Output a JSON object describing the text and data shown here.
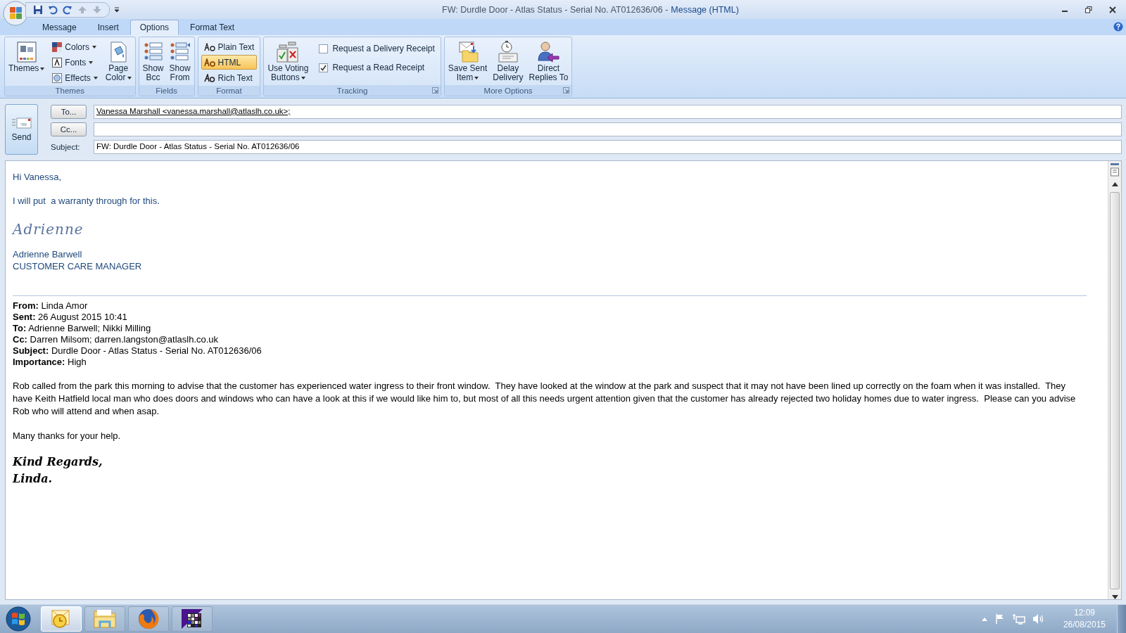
{
  "window": {
    "title": "FW: Durdle Door - Atlas Status - Serial No. AT012636/06 -",
    "app": "Message (HTML)"
  },
  "tabs": [
    {
      "label": "Message",
      "selected": false
    },
    {
      "label": "Insert",
      "selected": false
    },
    {
      "label": "Options",
      "selected": true
    },
    {
      "label": "Format Text",
      "selected": false
    }
  ],
  "ribbon": {
    "groups": [
      {
        "label": "Themes",
        "launcher": false,
        "items": [
          {
            "kind": "large",
            "lines": [
              "Themes"
            ],
            "dropdown": true
          },
          {
            "kind": "small",
            "label": "Colors",
            "dropdown": true
          },
          {
            "kind": "small",
            "label": "Fonts",
            "dropdown": true
          },
          {
            "kind": "small",
            "label": "Effects",
            "dropdown": true
          },
          {
            "kind": "large",
            "lines": [
              "Page",
              "Color"
            ],
            "dropdown": true
          }
        ]
      },
      {
        "label": "Fields",
        "launcher": false,
        "items": [
          {
            "kind": "large",
            "lines": [
              "Show",
              "Bcc"
            ],
            "dropdown": false
          },
          {
            "kind": "large",
            "lines": [
              "Show",
              "From"
            ],
            "dropdown": false
          }
        ]
      },
      {
        "label": "Format",
        "launcher": false,
        "items": [
          {
            "kind": "format",
            "label": "Plain Text",
            "selected": false
          },
          {
            "kind": "format",
            "label": "HTML",
            "selected": true
          },
          {
            "kind": "format",
            "label": "Rich Text",
            "selected": false
          }
        ]
      },
      {
        "label": "Tracking",
        "launcher": true,
        "items": [
          {
            "kind": "large",
            "lines": [
              "Use Voting",
              "Buttons"
            ],
            "dropdown": true
          },
          {
            "kind": "check",
            "label": "Request a Delivery Receipt",
            "checked": false
          },
          {
            "kind": "check",
            "label": "Request a Read Receipt",
            "checked": true
          }
        ]
      },
      {
        "label": "More Options",
        "launcher": true,
        "items": [
          {
            "kind": "large",
            "lines": [
              "Save Sent",
              "Item"
            ],
            "dropdown": true
          },
          {
            "kind": "large",
            "lines": [
              "Delay",
              "Delivery"
            ],
            "dropdown": false
          },
          {
            "kind": "large",
            "lines": [
              "Direct",
              "Replies To"
            ],
            "dropdown": false
          }
        ]
      }
    ]
  },
  "header": {
    "send": "Send",
    "to_button": "To...",
    "cc_button": "Cc...",
    "subject_label": "Subject:",
    "to": "Vanessa Marshall <vanessa.marshall@atlaslh.co.uk>;",
    "subject": "FW: Durdle Door - Atlas Status - Serial No. AT012636/06"
  },
  "message": {
    "greeting": "Hi Vanessa,",
    "line": "I will put  a warranty through for this.",
    "signature_script": "Adrienne",
    "sender_name": "Adrienne Barwell",
    "sender_title": "CUSTOMER CARE MANAGER",
    "forwarded": {
      "headers": [
        "**From:** Linda Amor",
        "**Sent:** 26 August 2015 10:41",
        "**To:** Adrienne Barwell; Nikki Milling",
        "**Cc:** Darren Milsom; darren.langston@atlaslh.co.uk",
        "**Subject:** Durdle Door - Atlas Status - Serial No. AT012636/06",
        "**Importance:** High"
      ],
      "paragraphs": [
        "Rob called from the park this morning to advise that the customer has experienced water ingress to their front window.  They have looked at the window at the park and suspect that it may not have been lined up correctly on the foam when it was installed.  They have Keith Hatfield local man who does doors and windows who can have a look at this if we would like him to, but most of all this needs urgent attention given that the customer has already rejected two holiday homes due to water ingress.  Please can you advise Rob who will attend and when asap.",
        "Many thanks for your help."
      ],
      "sign_off": [
        "Kind Regards,",
        "Linda."
      ]
    }
  },
  "taskbar": {
    "apps": [
      {
        "selected": true
      },
      {
        "selected": false
      },
      {
        "selected": false
      },
      {
        "selected": false
      }
    ],
    "time": "12:09",
    "date": "26/08/2015"
  }
}
